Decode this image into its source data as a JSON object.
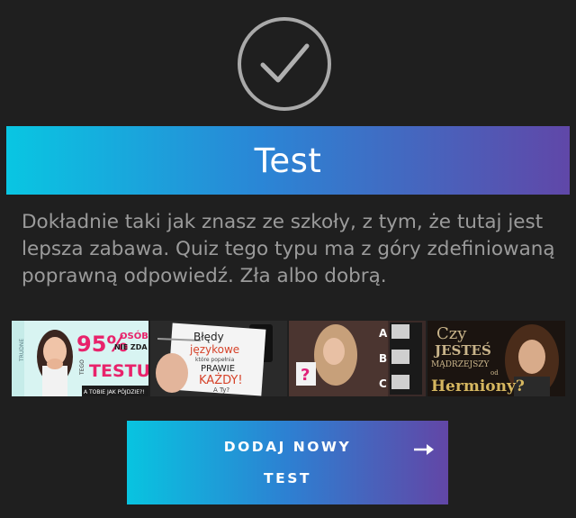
{
  "status": {
    "icon": "checkmark-circle-icon"
  },
  "banner": {
    "title": "Test"
  },
  "description": "Dokładnie taki jak znasz ze szkoły, z tym, że tutaj jest lepsza zabawa. Quiz tego typu ma z góry zdefiniowaną poprawną odpowiedź. Zła albo dobrą.",
  "thumbnails": [
    {
      "name": "thumb-trudne-95-procent",
      "texts": {
        "t1": "TRUDNE",
        "t2": "95%",
        "t3": "OSÓB",
        "t4": "NIE ZDA",
        "t5": "TEGO",
        "t6": "TESTU!",
        "t7": "A TOBIE JAK PÓJDZIE?!"
      }
    },
    {
      "name": "thumb-bledy-jezykowe",
      "texts": {
        "t1": "Błędy",
        "t2": "językowe",
        "t3": "które popełnia",
        "t4": "PRAWIE",
        "t5": "KAŻDY!",
        "t6": "A Ty?"
      }
    },
    {
      "name": "thumb-abc-quiz",
      "texts": {
        "t1": "?",
        "t2": "A",
        "t3": "B",
        "t4": "C"
      }
    },
    {
      "name": "thumb-hermiona",
      "texts": {
        "t1": "Czy",
        "t2": "JESTEŚ",
        "t3": "MĄDRZEJSZY",
        "t4": "od",
        "t5": "Hermiony?"
      }
    }
  ],
  "cta": {
    "line1": "DODAJ NOWY",
    "line2": "TEST",
    "icon": "arrow-right-icon"
  },
  "colors": {
    "background": "#1f1f1f",
    "gradient_start": "#09c6e2",
    "gradient_end": "#6047a8",
    "text_muted": "#9b9b9b",
    "check_stroke": "#a9a9a9"
  }
}
